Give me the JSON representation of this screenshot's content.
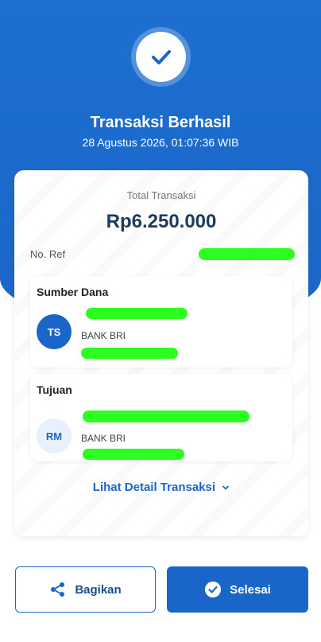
{
  "header": {
    "title": "Transaksi Berhasil",
    "datetime": "28 Agustus 2026, 01:07:36 WIB",
    "icon": "check-icon"
  },
  "summary": {
    "total_label": "Total Transaksi",
    "total_amount": "Rp6.250.000",
    "ref_label": "No. Ref"
  },
  "source": {
    "title": "Sumber Dana",
    "initials": "TS",
    "bank": "BANK BRI"
  },
  "destination": {
    "title": "Tujuan",
    "initials": "RM",
    "bank": "BANK BRI"
  },
  "detail_link": "Lihat Detail Transaksi",
  "buttons": {
    "share": "Bagikan",
    "done": "Selesai"
  },
  "colors": {
    "primary": "#1a66c8",
    "amount": "#1b3a5c",
    "redaction": "#2cff1f"
  }
}
